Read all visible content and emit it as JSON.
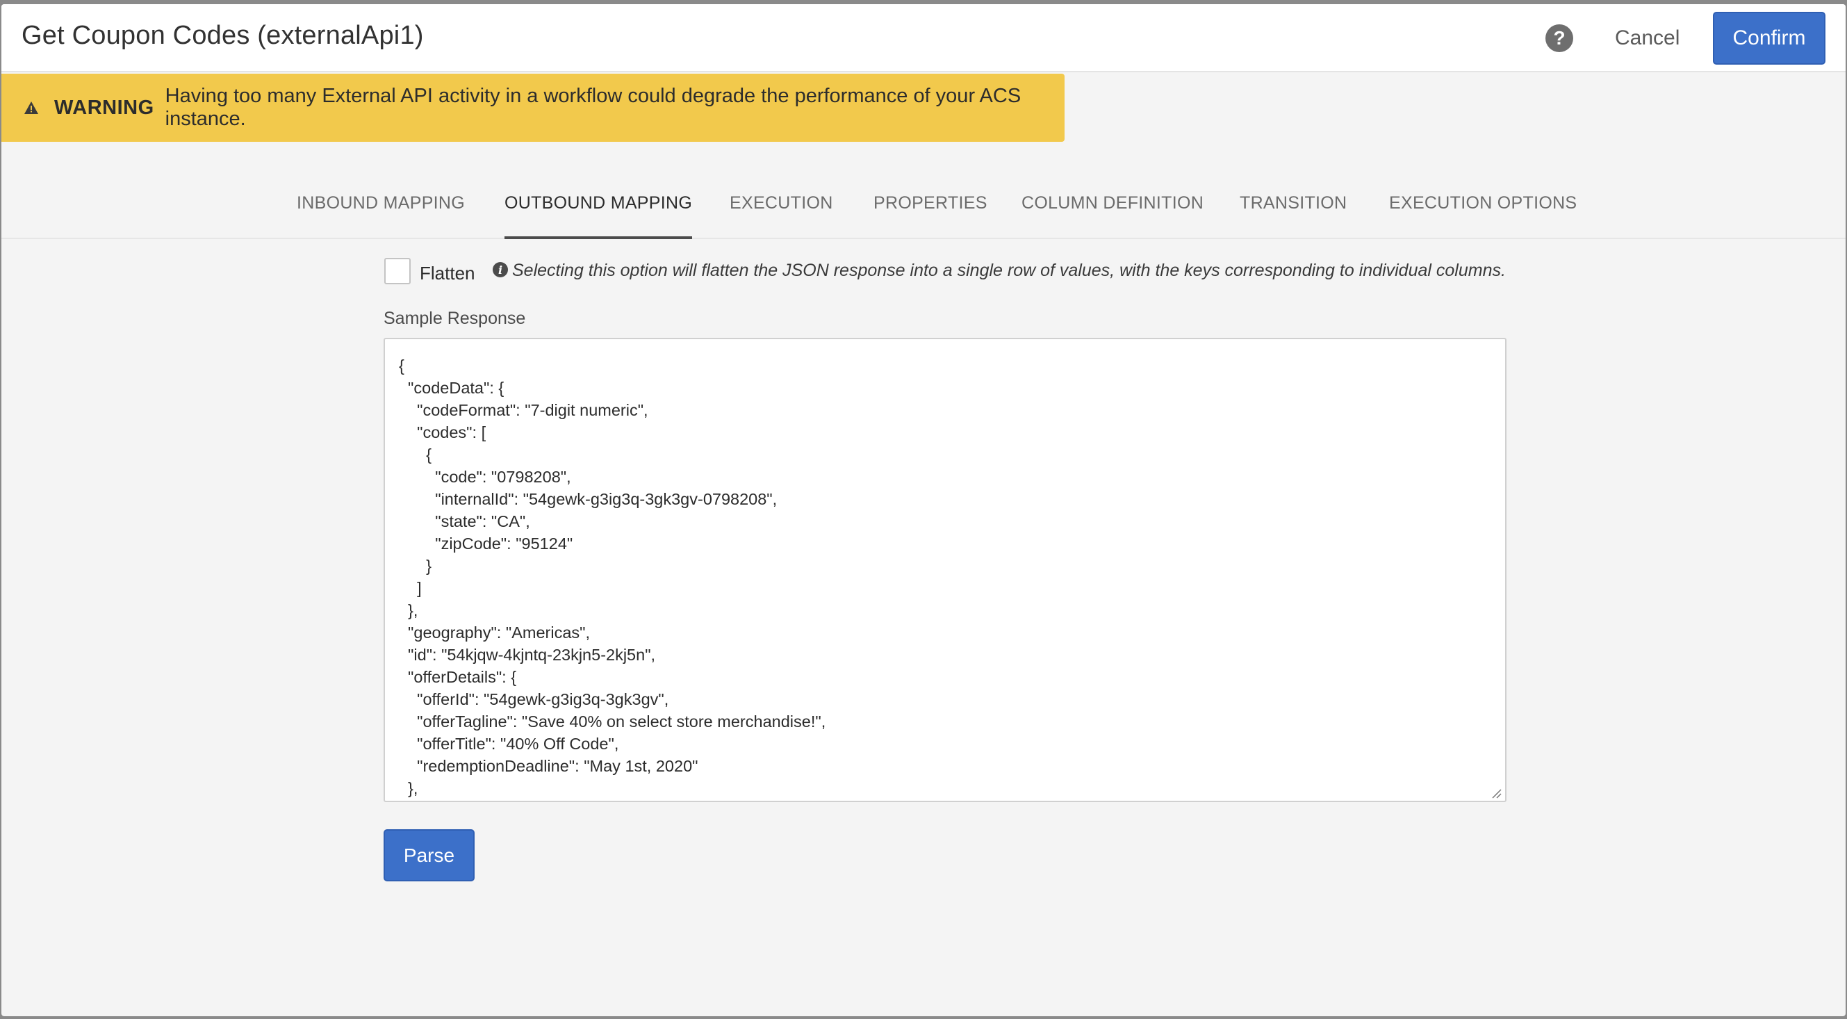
{
  "dialog": {
    "title": "Get Coupon Codes (externalApi1)",
    "help_icon": "question-mark-icon",
    "cancel_label": "Cancel",
    "confirm_label": "Confirm",
    "accent_color": "#3c70c9"
  },
  "warning": {
    "icon": "warning-triangle-icon",
    "label": "WARNING",
    "text": "Having too many External API activity in a workflow could degrade the performance of your ACS instance.",
    "background": "#f2c94c"
  },
  "tabs": [
    {
      "label": "INBOUND MAPPING",
      "active": false
    },
    {
      "label": "OUTBOUND MAPPING",
      "active": true
    },
    {
      "label": "EXECUTION",
      "active": false
    },
    {
      "label": "PROPERTIES",
      "active": false
    },
    {
      "label": "COLUMN DEFINITION",
      "active": false
    },
    {
      "label": "TRANSITION",
      "active": false
    },
    {
      "label": "EXECUTION OPTIONS",
      "active": false
    }
  ],
  "flatten": {
    "label": "Flatten",
    "checked": false,
    "hint": "Selecting this option will flatten the JSON response into a single row of values, with the keys corresponding to individual columns."
  },
  "sample_response": {
    "label": "Sample Response",
    "value": "{\n  \"codeData\": {\n    \"codeFormat\": \"7-digit numeric\",\n    \"codes\": [\n      {\n        \"code\": \"0798208\",\n        \"internalId\": \"54gewk-g3ig3q-3gk3gv-0798208\",\n        \"state\": \"CA\",\n        \"zipCode\": \"95124\"\n      }\n    ]\n  },\n  \"geography\": \"Americas\",\n  \"id\": \"54kjqw-4kjntq-23kjn5-2kj5n\",\n  \"offerDetails\": {\n    \"offerId\": \"54gewk-g3ig3q-3gk3gv\",\n    \"offerTagline\": \"Save 40% on select store merchandise!\",\n    \"offerTitle\": \"40% Off Code\",\n    \"redemptionDeadline\": \"May 1st, 2020\"\n  },"
  },
  "parse_label": "Parse"
}
